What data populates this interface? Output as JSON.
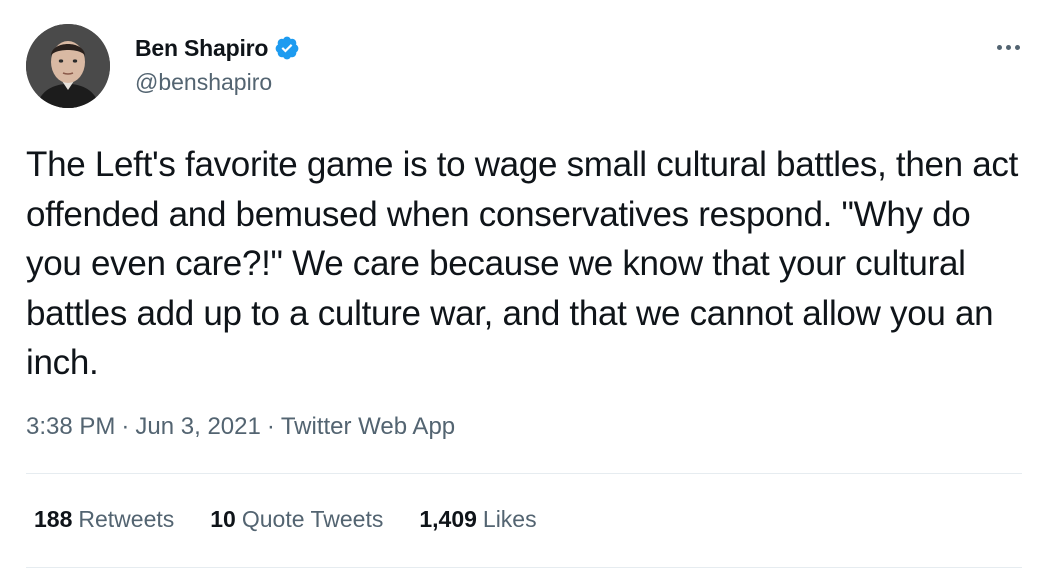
{
  "author": {
    "name": "Ben Shapiro",
    "handle": "@benshapiro",
    "verified_color": "#1d9bf0"
  },
  "tweet": {
    "text": "The Left's favorite game is to wage small cultural battles, then act offended and bemused when conservatives respond. \"Why do you even care?!\" We care because we know that your cultural battles add up to a culture war, and that we cannot allow you an inch.",
    "time": "3:38 PM",
    "date": "Jun 3, 2021",
    "source": "Twitter Web App",
    "separator": "·"
  },
  "stats": {
    "retweets_count": "188",
    "retweets_label": "Retweets",
    "quotes_count": "10",
    "quotes_label": "Quote Tweets",
    "likes_count": "1,409",
    "likes_label": "Likes"
  },
  "icons": {
    "verified": "verified-badge-icon",
    "more": "more-horizontal-icon",
    "avatar": "profile-photo"
  }
}
